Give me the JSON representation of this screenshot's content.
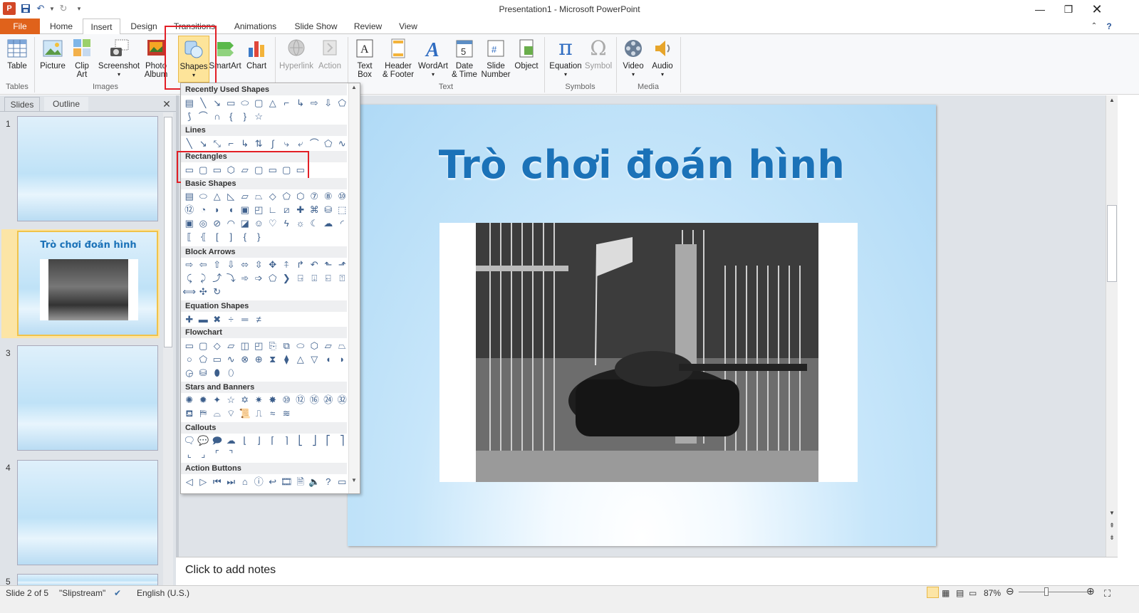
{
  "app": {
    "title": "Presentation1 - Microsoft PowerPoint"
  },
  "tabs": [
    "File",
    "Home",
    "Insert",
    "Design",
    "Transitions",
    "Animations",
    "Slide Show",
    "Review",
    "View"
  ],
  "ribbon": {
    "buttons": [
      {
        "id": "table",
        "label": "Table",
        "label2": ""
      },
      {
        "id": "picture",
        "label": "Picture",
        "label2": ""
      },
      {
        "id": "clipart",
        "label": "Clip",
        "label2": "Art"
      },
      {
        "id": "screenshot",
        "label": "Screenshot",
        "label2": ""
      },
      {
        "id": "photoalbum",
        "label": "Photo",
        "label2": "Album"
      },
      {
        "id": "shapes",
        "label": "Shapes",
        "label2": ""
      },
      {
        "id": "smartart",
        "label": "SmartArt",
        "label2": ""
      },
      {
        "id": "chart",
        "label": "Chart",
        "label2": ""
      },
      {
        "id": "hyperlink",
        "label": "Hyperlink",
        "label2": ""
      },
      {
        "id": "action",
        "label": "Action",
        "label2": ""
      },
      {
        "id": "textbox",
        "label": "Text",
        "label2": "Box"
      },
      {
        "id": "headerfooter",
        "label": "Header",
        "label2": "& Footer"
      },
      {
        "id": "wordart",
        "label": "WordArt",
        "label2": ""
      },
      {
        "id": "datetime",
        "label": "Date",
        "label2": "& Time"
      },
      {
        "id": "slidenumber",
        "label": "Slide",
        "label2": "Number"
      },
      {
        "id": "object",
        "label": "Object",
        "label2": ""
      },
      {
        "id": "equation",
        "label": "Equation",
        "label2": ""
      },
      {
        "id": "symbol",
        "label": "Symbol",
        "label2": ""
      },
      {
        "id": "video",
        "label": "Video",
        "label2": ""
      },
      {
        "id": "audio",
        "label": "Audio",
        "label2": ""
      }
    ],
    "groups": [
      "Tables",
      "Images",
      "Text",
      "Symbols",
      "Media"
    ]
  },
  "panes": {
    "slides_tab": "Slides",
    "outline_tab": "Outline"
  },
  "thumbs": [
    {
      "num": "1"
    },
    {
      "num": "2",
      "title": "Trò chơi đoán hình"
    },
    {
      "num": "3"
    },
    {
      "num": "4"
    },
    {
      "num": "5"
    }
  ],
  "gallery": {
    "sections": [
      "Recently Used Shapes",
      "Lines",
      "Rectangles",
      "Basic Shapes",
      "Block Arrows",
      "Equation Shapes",
      "Flowchart",
      "Stars and Banners",
      "Callouts",
      "Action Buttons"
    ]
  },
  "slide": {
    "title": "Trò chơi đoán hình"
  },
  "notes": {
    "placeholder": "Click to add notes"
  },
  "status": {
    "slide": "Slide 2 of 5",
    "theme": "\"Slipstream\"",
    "language": "English (U.S.)",
    "zoom": "87%"
  },
  "colors": {
    "file_tab": "#e0621b",
    "title_text": "#1b72b8",
    "highlight": "#e21f26"
  }
}
